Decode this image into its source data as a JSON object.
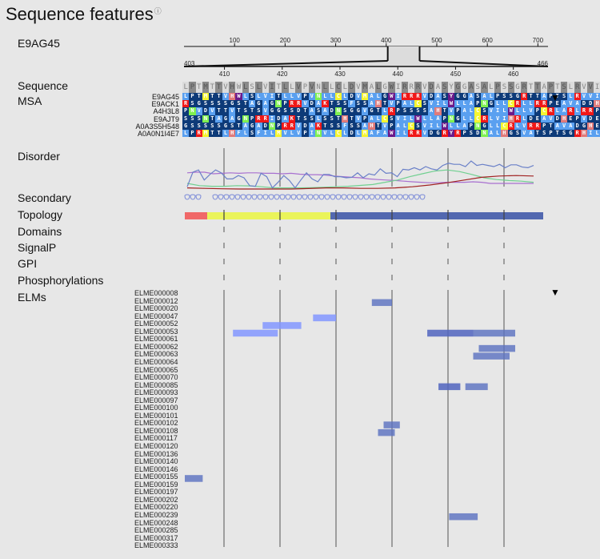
{
  "title": "Sequence features",
  "info_icon": "info-circle-icon",
  "protein_id": "E9AG45",
  "overview": {
    "full_ticks": [
      "100",
      "200",
      "300",
      "400",
      "500",
      "600",
      "700"
    ],
    "full_length": 720,
    "window_start": 403,
    "window_end": 466,
    "zoom_start_label": "403",
    "zoom_end_label": "466",
    "zoom_ticks": [
      "410",
      "420",
      "430",
      "440",
      "450",
      "460"
    ]
  },
  "labels": {
    "sequence": "Sequence",
    "msa": "MSA",
    "disorder": "Disorder",
    "secondary": "Secondary",
    "topology": "Topology",
    "domains": "Domains",
    "signalp": "SignalP",
    "gpi": "GPI",
    "phosphorylations": "Phosphorylations",
    "elms": "ELMs"
  },
  "sequence": "LPTMTTVHWLSLVITLLVPVNLLCLDVMALGWIRRRVDASYGGASALPSSGRTTAPTSLRVVIC",
  "msa": [
    {
      "name": "E9AG45",
      "seq": "LPTMTTVHWLSLVITLLVPVNLLCLDVMALGWIRRRVDASYGGASALPSSGRTTAPTSLRVVIC"
    },
    {
      "name": "E9ACK1",
      "seq": "RSGSSSSGSTAGAGNPRRVDAKTSSFSSAHTVPALCSVILWLLAPNGLLCRLLRRPEAVADDHE"
    },
    {
      "name": "A4H3L8",
      "seq": "PNVDVTTVTSTSVGGSSDTASADNSGGVGTLRPSSSSAHTVPALCSVILWLLVPCRLARLRRPS"
    },
    {
      "name": "E9AJT9",
      "seq": "SSSNTAGAGNPRRIDAKTSSLSSTHTVPALCSVILWLLAPNGLLCRLVIHRLDEAVDHEPVDES"
    },
    {
      "name": "A0A3S5H548",
      "seq": "GSSSSSGSTAGADNPRRVDAKTSSFSSAHTVPALCSVILWLLAPNGLLCRLVRRPTAVADGHEP"
    },
    {
      "name": "A0A0N1I4E7",
      "seq": "LPRMTTLHFLSFILMVLVPINVLCLDLMAFAWILRRVDGRYRPSDNALHGSVATSPTSGRHILM"
    }
  ],
  "colors": {
    "msa_default": "#5aa0f0",
    "msa_dark": "#0d3a78",
    "msa_red": "#f01818",
    "msa_yellow": "#f5f530",
    "msa_green": "#7ff050",
    "msa_purple": "#6b1a8a",
    "msa_pink": "#e07a7a",
    "topology_signal": "#f06868",
    "topology_extra": "#eaf45a",
    "topology_membrane": "#5268b0",
    "disorder_blue": "#6a80c8",
    "disorder_purple": "#a870d0",
    "disorder_green": "#70d090",
    "disorder_red": "#a02020",
    "elm_light": "#8fa0ff",
    "elm_dark": "#5a70c0"
  },
  "disorder": {
    "blue": [
      0.1,
      0.75,
      0.85,
      0.4,
      0.65,
      0.85,
      0.72,
      0.45,
      0.45,
      0.6,
      0.5,
      0.15,
      0.12,
      0.7,
      0.55,
      0.05,
      0.3,
      0.6,
      0.38,
      0.05,
      0.4,
      0.72,
      0.45,
      0.32,
      0.65,
      0.65,
      0.55,
      0.55,
      0.5,
      0.52,
      0.72,
      0.5,
      0.68,
      0.62,
      0.9,
      0.7,
      0.72,
      0.55,
      0.88,
      0.85,
      0.95,
      0.85,
      1.0,
      0.9,
      0.85,
      1.05,
      1.15,
      1.1,
      1.1,
      1.0,
      1.25,
      1.05,
      1.1,
      1.05,
      1.0,
      1.1,
      0.95,
      1.08,
      1.08,
      0.98,
      0.95,
      1.05
    ],
    "purple": [
      0.72,
      0.75,
      0.75,
      0.68,
      0.7,
      0.72,
      0.7,
      0.72,
      0.72,
      0.7,
      0.7,
      0.68,
      0.7,
      0.66,
      0.64,
      0.64,
      0.62,
      0.58,
      0.55,
      0.52,
      0.5,
      0.45,
      0.42,
      0.4,
      0.38,
      0.35,
      0.32,
      0.3,
      0.28,
      0.28,
      0.3,
      0.3,
      0.3,
      0.32,
      0.3,
      0.25,
      0.25,
      0.25,
      0.25,
      0.25,
      0.25
    ],
    "green": [
      0.25,
      0.15,
      0.12,
      0.12,
      0.15,
      0.14,
      0.1,
      0.05,
      0.05,
      0.05,
      0.06,
      0.08,
      0.1,
      0.12,
      0.16,
      0.2,
      0.3,
      0.4,
      0.55,
      0.68,
      0.8,
      0.85,
      0.78,
      0.65,
      0.5,
      0.42,
      0.38,
      0.35,
      0.3
    ],
    "red": [
      0.05,
      0.03,
      0.01,
      0.0,
      0.0,
      0.0,
      0.0,
      0.02,
      0.05,
      0.05,
      0.03,
      0.03,
      0.05,
      0.1,
      0.18,
      0.28,
      0.4,
      0.52,
      0.58,
      0.6,
      0.58
    ]
  },
  "secondary": {
    "helices": [
      [
        403,
        406
      ],
      [
        408,
        429
      ],
      [
        429,
        446
      ]
    ]
  },
  "topology": [
    {
      "type": "signal",
      "start": 403,
      "end": 407
    },
    {
      "type": "extracellular",
      "start": 407,
      "end": 429
    },
    {
      "type": "membrane",
      "start": 429,
      "end": 467
    }
  ],
  "elms": {
    "names": [
      "ELME000008",
      "ELME000012",
      "ELME000020",
      "ELME000047",
      "ELME000052",
      "ELME000053",
      "ELME000061",
      "ELME000062",
      "ELME000063",
      "ELME000064",
      "ELME000065",
      "ELME000070",
      "ELME000085",
      "ELME000093",
      "ELME000097",
      "ELME000100",
      "ELME000101",
      "ELME000102",
      "ELME000108",
      "ELME000117",
      "ELME000120",
      "ELME000136",
      "ELME000140",
      "ELME000146",
      "ELME000155",
      "ELME000159",
      "ELME000197",
      "ELME000202",
      "ELME000220",
      "ELME000239",
      "ELME000248",
      "ELME000285",
      "ELME000317",
      "ELME000333"
    ],
    "hits": [
      {
        "elm": "ELME000012",
        "start": 436.4,
        "end": 440.0,
        "shade": "dark"
      },
      {
        "elm": "ELME000047",
        "start": 425.9,
        "end": 430.0,
        "shade": "light"
      },
      {
        "elm": "ELME000052",
        "start": 416.9,
        "end": 423.8,
        "shade": "light"
      },
      {
        "elm": "ELME000053",
        "start": 411.6,
        "end": 419.6,
        "shade": "light"
      },
      {
        "elm": "ELME000053",
        "start": 446.3,
        "end": 454.5,
        "shade": "darker"
      },
      {
        "elm": "ELME000053",
        "start": 454.5,
        "end": 462.0,
        "shade": "dark"
      },
      {
        "elm": "ELME000062",
        "start": 455.5,
        "end": 462.0,
        "shade": "dark"
      },
      {
        "elm": "ELME000063",
        "start": 454.5,
        "end": 461.0,
        "shade": "dark"
      },
      {
        "elm": "ELME000085",
        "start": 448.3,
        "end": 452.2,
        "shade": "darker"
      },
      {
        "elm": "ELME000085",
        "start": 453.1,
        "end": 457.1,
        "shade": "dark"
      },
      {
        "elm": "ELME000102",
        "start": 438.5,
        "end": 441.4,
        "shade": "dark"
      },
      {
        "elm": "ELME000108",
        "start": 437.5,
        "end": 440.5,
        "shade": "dark"
      },
      {
        "elm": "ELME000155",
        "start": 403.0,
        "end": 406.2,
        "shade": "dark"
      },
      {
        "elm": "ELME000239",
        "start": 450.2,
        "end": 455.3,
        "shade": "dark"
      }
    ]
  }
}
